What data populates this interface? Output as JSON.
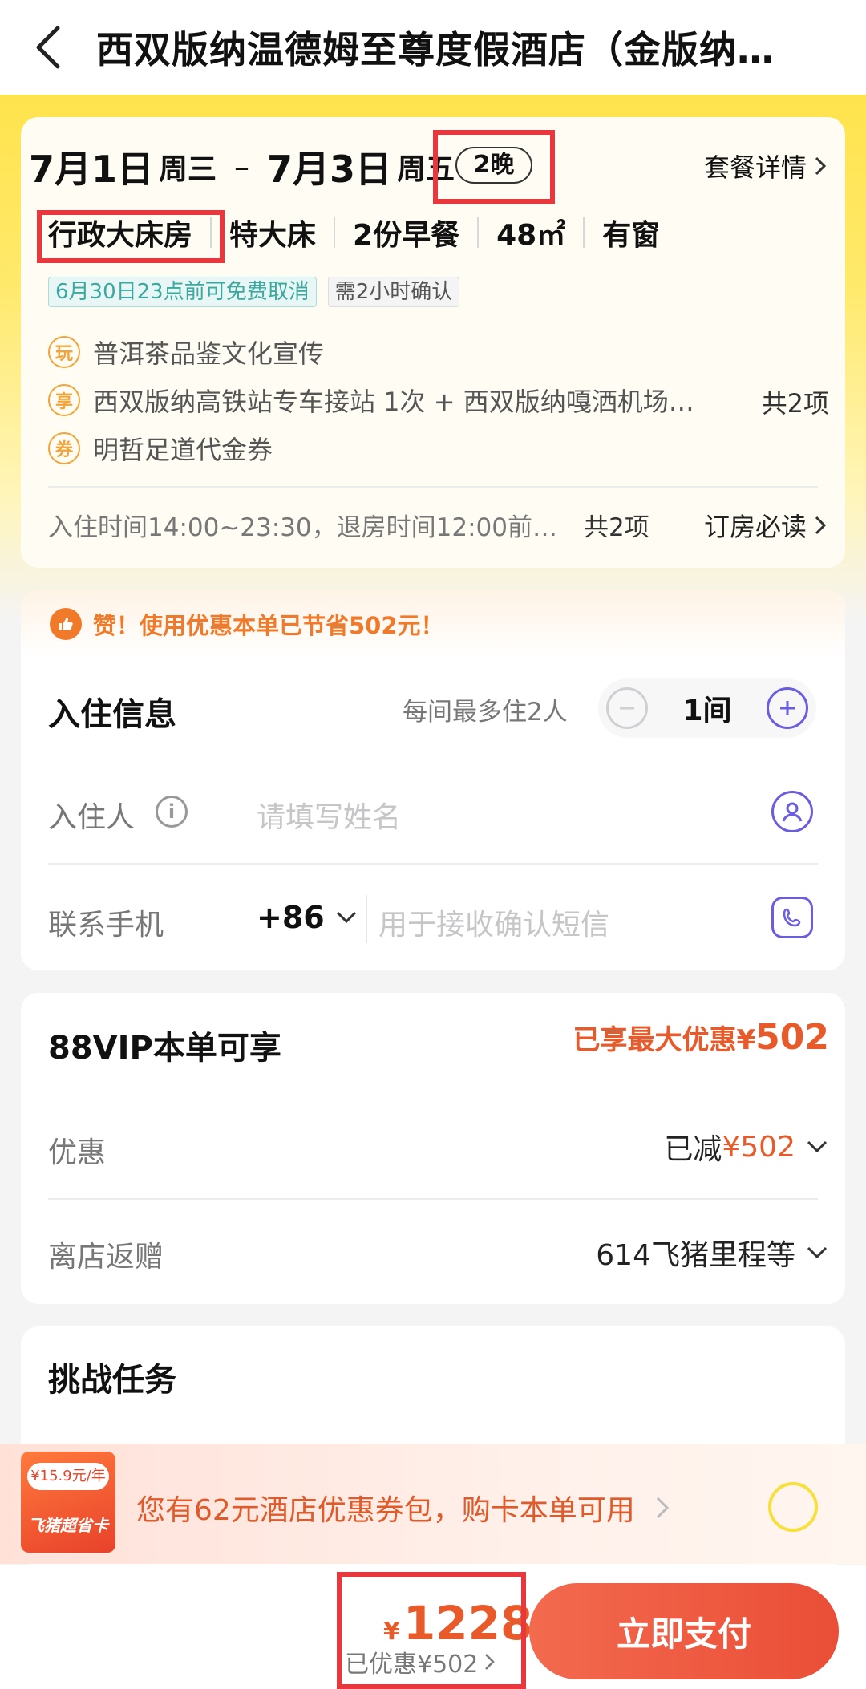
{
  "header": {
    "title": "西双版纳温德姆至尊度假酒店（金版纳…"
  },
  "package": {
    "checkin_date": "7月1日",
    "checkin_day": "周三",
    "checkout_date": "7月3日",
    "checkout_day": "周五",
    "dash": "–",
    "nights": "2晚",
    "detail_link": "套餐详情",
    "room_type": "行政大床房",
    "bed": "特大床",
    "breakfast": "2份早餐",
    "area": "48㎡",
    "window": "有窗",
    "tags": [
      "6月30日23点前可免费取消",
      "需2小时确认"
    ],
    "perks": [
      {
        "icon": "玩",
        "text": "普洱茶品鉴文化宣传"
      },
      {
        "icon": "享",
        "text": "西双版纳高铁站专车接站 1次 + 西双版纳嘎洒机场…"
      },
      {
        "icon": "券",
        "text": "明哲足道代金券"
      }
    ],
    "perk_count": "共2项",
    "checkin_notice": "入住时间14:00~23:30，退房时间12:00前…",
    "notice_count": "共2项",
    "must_read": "订房必读"
  },
  "guest": {
    "savings_banner": "赞！使用优惠本单已节省502元！",
    "section_title": "入住信息",
    "max_guests": "每间最多住2人",
    "room_count": "1间",
    "guest_label": "入住人",
    "guest_placeholder": "请填写姓名",
    "phone_label": "联系手机",
    "country_code": "+86",
    "phone_placeholder": "用于接收确认短信"
  },
  "vip": {
    "title": "88VIP本单可享",
    "max_prefix": "已享最大优惠¥",
    "max_amount": "502",
    "discount_label": "优惠",
    "discount_prefix": "已减",
    "discount_value": "¥502",
    "rebate_label": "离店返赠",
    "rebate_value": "614飞猪里程等"
  },
  "task": {
    "title": "挑战任务"
  },
  "promo": {
    "card_price": "¥15.9元/年",
    "card_name": "飞猪超省卡",
    "text": "您有62元酒店优惠券包，购卡本单可用"
  },
  "footer": {
    "currency": "¥",
    "total": "1228",
    "discount_note": "已优惠¥502",
    "pay_label": "立即支付"
  },
  "colors": {
    "accent": "#e85a2a",
    "brand_yellow": "#ffe34d",
    "purple": "#6a5de0",
    "highlight": "#e8383d"
  }
}
